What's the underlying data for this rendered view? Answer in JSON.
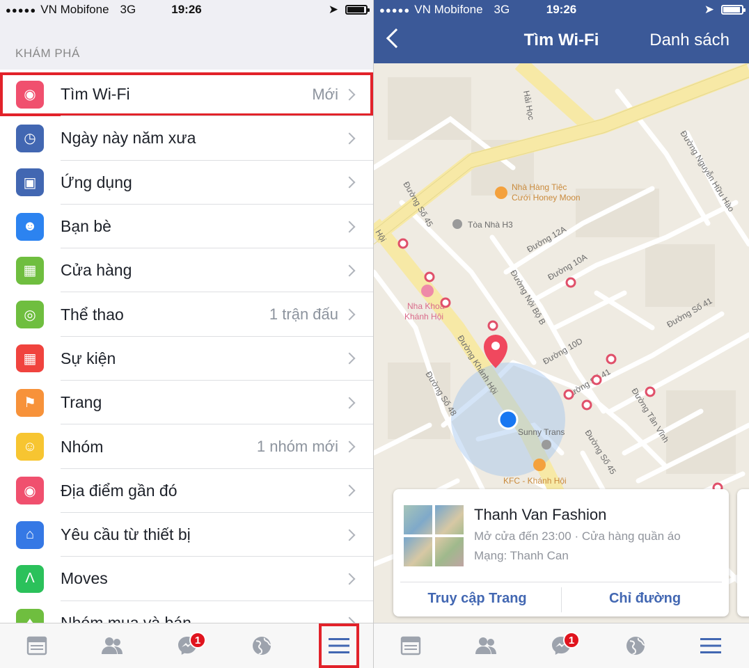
{
  "left": {
    "status": {
      "carrier": "VN Mobifone",
      "network": "3G",
      "time": "19:26"
    },
    "section_title": "KHÁM PHÁ",
    "items": [
      {
        "label": "Tìm Wi-Fi",
        "meta": "Mới",
        "icon": "wifi-icon",
        "color": "#f0506e"
      },
      {
        "label": "Ngày này năm xưa",
        "meta": "",
        "icon": "clock-icon",
        "color": "#4267b2"
      },
      {
        "label": "Ứng dụng",
        "meta": "",
        "icon": "cube-icon",
        "color": "#4267b2"
      },
      {
        "label": "Bạn bè",
        "meta": "",
        "icon": "friends-icon",
        "color": "#2c83f0"
      },
      {
        "label": "Cửa hàng",
        "meta": "",
        "icon": "store-icon",
        "color": "#6fbe3f"
      },
      {
        "label": "Thể thao",
        "meta": "1 trận đấu",
        "icon": "ball-icon",
        "color": "#6fbe3f"
      },
      {
        "label": "Sự kiện",
        "meta": "",
        "icon": "calendar-icon",
        "color": "#f0433e"
      },
      {
        "label": "Trang",
        "meta": "",
        "icon": "flag-icon",
        "color": "#f7923a"
      },
      {
        "label": "Nhóm",
        "meta": "1 nhóm mới",
        "icon": "group-icon",
        "color": "#f7c531"
      },
      {
        "label": "Địa điểm gần đó",
        "meta": "",
        "icon": "pin-icon",
        "color": "#f0506e"
      },
      {
        "label": "Yêu cầu từ thiết bị",
        "meta": "",
        "icon": "device-home-icon",
        "color": "#3578e5"
      },
      {
        "label": "Moves",
        "meta": "",
        "icon": "moves-icon",
        "color": "#2bc15b"
      },
      {
        "label": "Nhóm mua và bán",
        "meta": "",
        "icon": "shop-group-icon",
        "color": "#6fbe3f"
      }
    ],
    "tabbar": {
      "messenger_badge": "1"
    }
  },
  "right": {
    "status": {
      "carrier": "VN Mobifone",
      "network": "3G",
      "time": "19:26"
    },
    "header": {
      "title": "Tìm Wi-Fi",
      "action": "Danh sách"
    },
    "map_labels": {
      "street_top": "Hải Học",
      "restaurant": "Nhà Hàng Tiệc",
      "restaurant2": "Cưới Honey Moon",
      "building": "Tòa Nhà H3",
      "dental": "Nha Khoa",
      "dental2": "Khánh Hội",
      "s45a": "Đường Số 45",
      "s12a": "Đường 12A",
      "s10a": "Đường 10A",
      "noibo": "Đường Nội Bộ B",
      "khanhhoi": "Đường Khánh Hội",
      "s48": "Đường Số 48",
      "s10d": "Đường 10D",
      "s41": "Đường Số 41",
      "s41b": "Đường Số 41",
      "nguyenhuuhao": "Đường Nguyễn Hữu Hào",
      "tanvinh": "Đường Tân Vĩnh",
      "s45b": "Đường Số 45",
      "sunny": "Sunny Trans",
      "kfc": "KFC - Khánh Hội",
      "hoi": "Hội"
    },
    "card": {
      "name": "Thanh Van Fashion",
      "line1": "Mở cửa đến 23:00 · Cửa hàng quần áo",
      "line2": "Mạng: Thanh Can",
      "btn_visit": "Truy cập Trang",
      "btn_directions": "Chỉ đường"
    },
    "tabbar": {
      "messenger_badge": "1"
    }
  },
  "colors": {
    "fb_blue": "#3b5998",
    "highlight_red": "#e2222a",
    "wifi_marker": "#e0506a",
    "user_dot": "#1877f2"
  }
}
